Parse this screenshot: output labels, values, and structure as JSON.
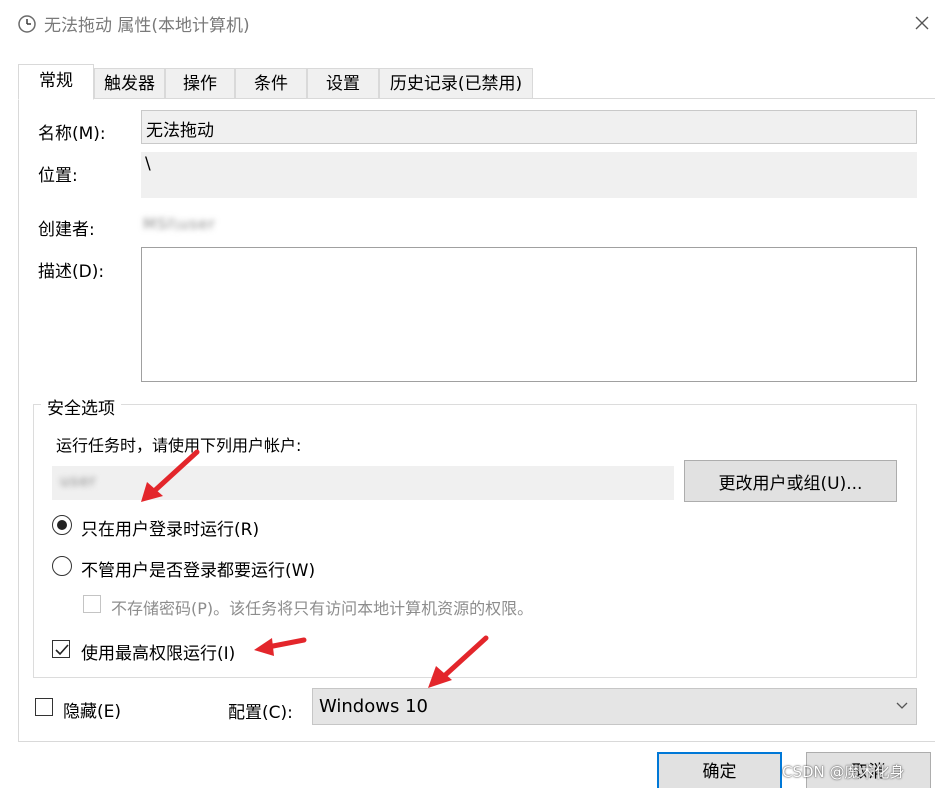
{
  "window": {
    "title": "无法拖动 属性(本地计算机)",
    "icon": "clock-icon",
    "close_icon": "close-icon"
  },
  "tabs": [
    {
      "label": "常规",
      "active": true
    },
    {
      "label": "触发器",
      "active": false
    },
    {
      "label": "操作",
      "active": false
    },
    {
      "label": "条件",
      "active": false
    },
    {
      "label": "设置",
      "active": false
    },
    {
      "label": "历史记录(已禁用)",
      "active": false
    }
  ],
  "general": {
    "name_label": "名称(M):",
    "name_value": "无法拖动",
    "location_label": "位置:",
    "location_value": "\\",
    "author_label": "创建者:",
    "author_value": "MSI\\user",
    "description_label": "描述(D):",
    "description_value": ""
  },
  "security": {
    "group_title": "安全选项",
    "run_as_label": "运行任务时，请使用下列用户帐户:",
    "account_value": "user",
    "change_user_button": "更改用户或组(U)...",
    "radio_logged_on": {
      "label": "只在用户登录时运行(R)",
      "checked": true
    },
    "radio_any": {
      "label": "不管用户是否登录都要运行(W)",
      "checked": false
    },
    "no_store_password": {
      "label": "不存储密码(P)。该任务将只有访问本地计算机资源的权限。",
      "checked": false,
      "enabled": false
    },
    "highest_privileges": {
      "label": "使用最高权限运行(I)",
      "checked": true
    }
  },
  "bottom": {
    "hidden": {
      "label": "隐藏(E)",
      "checked": false
    },
    "configure_label": "配置(C):",
    "configure_value": "Windows 10"
  },
  "buttons": {
    "ok": "确定",
    "cancel": "取消"
  },
  "watermark": "CSDN @魔术化身",
  "colors": {
    "arrow": "#e3262b",
    "ok_border": "#0078d7"
  }
}
